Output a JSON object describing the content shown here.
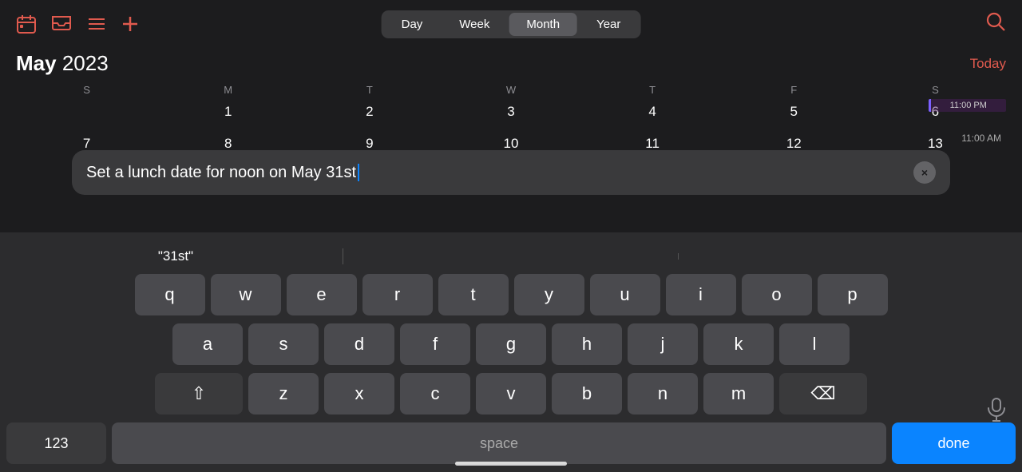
{
  "topbar": {
    "segments": [
      "Day",
      "Week",
      "Month",
      "Year"
    ],
    "active_segment": "Month"
  },
  "calendar": {
    "month": "May",
    "year": "2023",
    "today_label": "Today",
    "day_headers": [
      "S",
      "M",
      "T",
      "W",
      "T",
      "F",
      "S"
    ],
    "row1": [
      "1",
      "2",
      "3",
      "4",
      "5",
      "6"
    ],
    "row2": [
      "7",
      "8",
      "9",
      "10",
      "11",
      "12",
      "13"
    ],
    "event_time1": "11:00 PM",
    "event_time2": "11:00 AM"
  },
  "input_bar": {
    "text": "Set a lunch date for noon on May 31st",
    "clear_icon": "×"
  },
  "predictive": {
    "words": [
      "\"31st\"",
      "",
      ""
    ]
  },
  "keyboard": {
    "row1": [
      "q",
      "w",
      "e",
      "r",
      "t",
      "y",
      "u",
      "i",
      "o",
      "p"
    ],
    "row2": [
      "a",
      "s",
      "d",
      "f",
      "g",
      "h",
      "j",
      "k",
      "l"
    ],
    "row3": [
      "z",
      "x",
      "c",
      "v",
      "b",
      "n",
      "m"
    ],
    "shift_label": "⇧",
    "delete_label": "⌫",
    "num_label": "123",
    "space_label": "space",
    "done_label": "done"
  },
  "bottom_bar_visible": true,
  "mic_icon": "mic"
}
